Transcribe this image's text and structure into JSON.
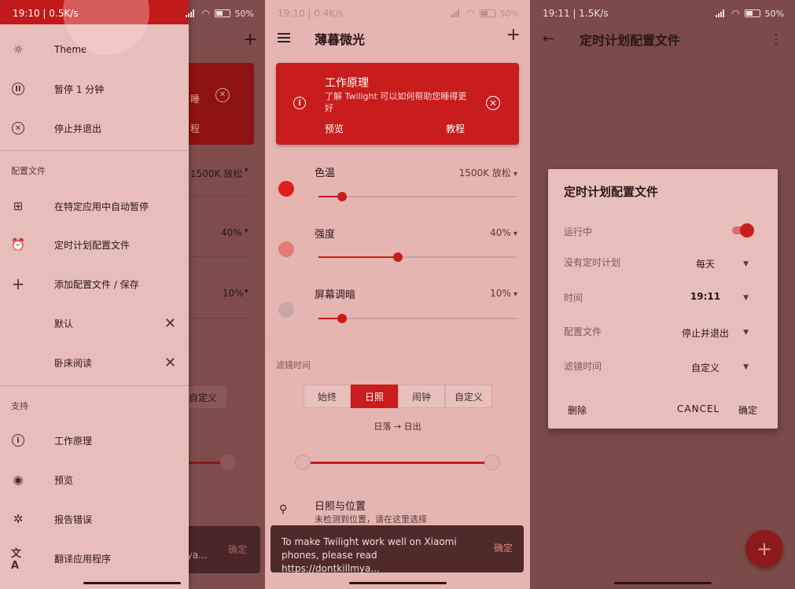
{
  "panel1": {
    "status_time": "19:10 | 0.5K/s",
    "status_battery": "50%",
    "drawer": {
      "top_items": [
        {
          "icon": "theme-icon",
          "label": "Theme"
        },
        {
          "icon": "pause-icon",
          "label": "暂停 1 分钟"
        },
        {
          "icon": "close-circle-icon",
          "label": "停止并退出"
        }
      ],
      "profiles_header": "配置文件",
      "profile_items": [
        {
          "icon": "apps-grid-icon",
          "label": "在特定应用中自动暂停"
        },
        {
          "icon": "alarm-icon",
          "label": "定时计划配置文件"
        },
        {
          "icon": "plus-icon",
          "label": "添加配置文件 / 保存"
        }
      ],
      "saved_profiles": [
        {
          "label": "默认"
        },
        {
          "label": "卧床阅读"
        }
      ],
      "support_header": "支持",
      "support_items": [
        {
          "icon": "info-icon",
          "label": "工作原理"
        },
        {
          "icon": "eye-icon",
          "label": "预览"
        },
        {
          "icon": "bug-icon",
          "label": "报告错误"
        },
        {
          "icon": "translate-icon",
          "label": "翻译应用程序"
        }
      ]
    },
    "peek": {
      "color_temp": "1500K 放松",
      "intensity": "40%",
      "dim": "10%",
      "card_fragment_1": "睡",
      "card_fragment_2": "程",
      "chip": "自定义",
      "snack_fragment_1": "i",
      "snack_fragment_2": "mya...",
      "snack_action": "确定"
    }
  },
  "panel2": {
    "status_time": "19:10 | 0.4K/s",
    "status_battery": "50%",
    "title": "薄暮微光",
    "card": {
      "title": "工作原理",
      "description": "了解 Twilight 可以如何帮助您睡得更好",
      "btn_preview": "预览",
      "btn_tutorial": "教程"
    },
    "settings": [
      {
        "label": "色温",
        "value": "1500K 放松",
        "level": 0.12,
        "color": "#e0201c"
      },
      {
        "label": "强度",
        "value": "40%",
        "level": 0.4,
        "color": "#e57b73"
      },
      {
        "label": "屏幕调暗",
        "value": "10%",
        "level": 0.12,
        "color": "#caa7a5"
      }
    ],
    "filter_time_label": "滤镜时间",
    "segments": [
      {
        "label": "始终",
        "active": false
      },
      {
        "label": "日照",
        "active": true
      },
      {
        "label": "闹钟",
        "active": false
      },
      {
        "label": "自定义",
        "active": false
      }
    ],
    "sun_text": "日落 → 日出",
    "location_title": "日照与位置",
    "location_sub": "未检测到位置，请在这里选择",
    "snackbar": {
      "text": "To make Twilight work well on Xiaomi phones, please read https://dontkillmya...",
      "action": "确定"
    }
  },
  "panel3": {
    "status_time": "19:11 | 1.5K/s",
    "status_battery": "50%",
    "title": "定时计划配置文件",
    "dialog": {
      "title": "定时计划配置文件",
      "running_label": "运行中",
      "running_on": true,
      "rows": [
        {
          "label": "没有定时计划",
          "value": "每天"
        },
        {
          "label": "时间",
          "value": "19:11"
        },
        {
          "label": "配置文件",
          "value": "停止并退出"
        },
        {
          "label": "滤镜时间",
          "value": "自定义"
        }
      ],
      "delete": "删除",
      "cancel": "CANCEL",
      "ok": "确定"
    },
    "fab": "+"
  }
}
